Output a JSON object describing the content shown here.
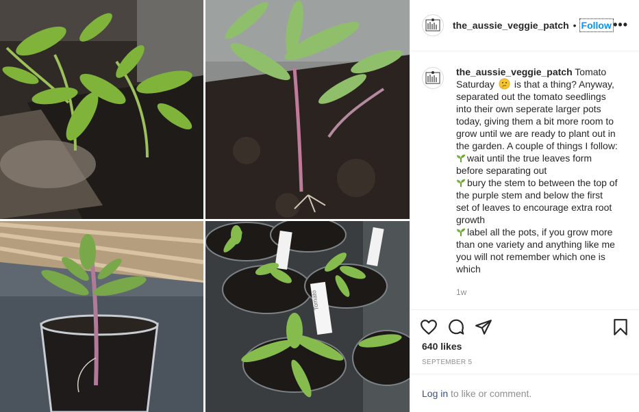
{
  "post": {
    "username": "the_aussie_veggie_patch",
    "follow_label": "Follow",
    "separator": "•",
    "more_label": "•••",
    "caption": {
      "username": "the_aussie_veggie_patch",
      "line1_before_emoji": "Tomato Saturday",
      "line1_after_emoji": "is that a thing? Anyway, separated out the tomato seedlings into their own seperate larger pots today, giving them a bit more room to grow until we are ready to plant out in the garden. A couple of things I follow:",
      "tips": [
        "wait until the true leaves form before separating out",
        "bury the stem to between the top of the purple stem and below the first set of leaves to encourage extra root growth",
        "label all the pots, if you grow more than one variety and anything like me you will not remember which one is which"
      ]
    },
    "time_ago": "1w",
    "likes": "640 likes",
    "date": "SEPTEMBER 5",
    "login_link": "Log in",
    "login_rest": " to like or comment."
  },
  "photos": {
    "pot_labels": [
      "Tomato",
      "Tomato"
    ]
  },
  "colors": {
    "accent": "#0095f6",
    "text": "#262626",
    "muted": "#8e8e8e",
    "link": "#385185",
    "border": "#efefef"
  },
  "icons": [
    "heart-icon",
    "comment-icon",
    "share-icon",
    "bookmark-icon",
    "more-options-icon",
    "seedling-emoji-icon",
    "thinking-face-emoji-icon"
  ]
}
